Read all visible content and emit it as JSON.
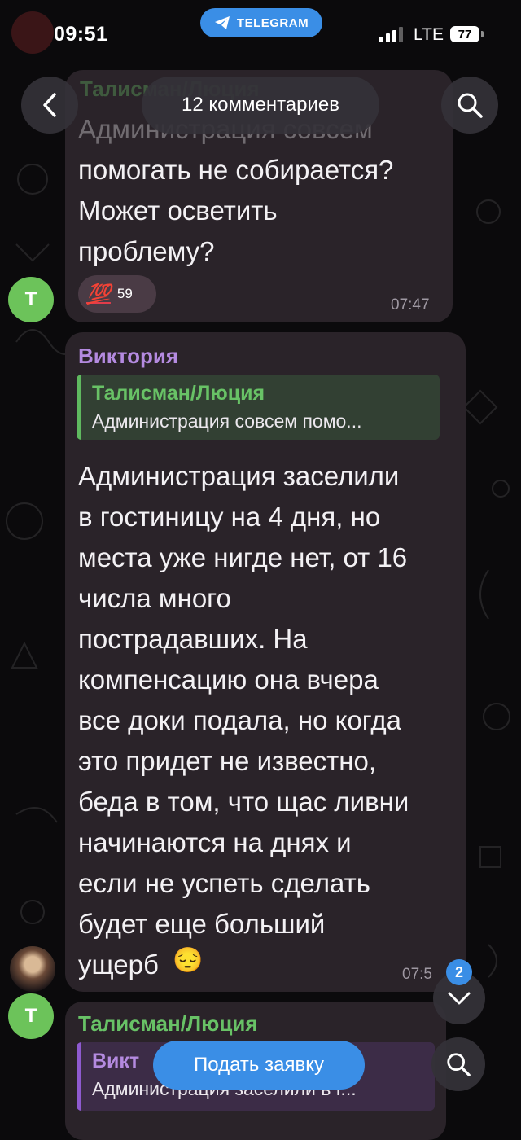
{
  "status_bar": {
    "time": "09:51",
    "telegram_label": "TELEGRAM",
    "network": "LTE",
    "battery": "77"
  },
  "header": {
    "title": "12 комментариев"
  },
  "messages": [
    {
      "sender_faded": "Талисман/Люция",
      "text_faded": "Администрация совсем",
      "text": "помогать не собирается?\nМожет осветить\nпроблему?",
      "reaction": {
        "emoji": "💯",
        "count": "59"
      },
      "time": "07:47",
      "avatar_letter": "Т"
    },
    {
      "sender": "Виктория",
      "sender_color": "#b48ae0",
      "reply": {
        "name": "Талисман/Люция",
        "text": "Администрация совсем помо..."
      },
      "text": "Администрация заселили\nв гостиницу на 4 дня, но\nместа уже нигде нет, от 16\nчисла много\nпострадавших. На\nкомпенсацию она вчера\nвсе доки подала, но когда\nэто придет не известно,\nбеда в том, что щас ливни\nначинаются на днях и\nесли не успеть сделать\nбудет еще больший\nущерб",
      "emoji_end": "😔",
      "time": "07:5"
    },
    {
      "sender": "Талисман/Люция",
      "sender_color": "#68c266",
      "avatar_letter": "Т",
      "reply": {
        "name": "Викт",
        "text": "Администрация заселили в г..."
      }
    }
  ],
  "unread_count": "2",
  "apply_button": "Подать заявку",
  "colors": {
    "accent": "#3a8ee6",
    "bubble": "#2a2329",
    "avatar_green": "#6cc35a"
  }
}
